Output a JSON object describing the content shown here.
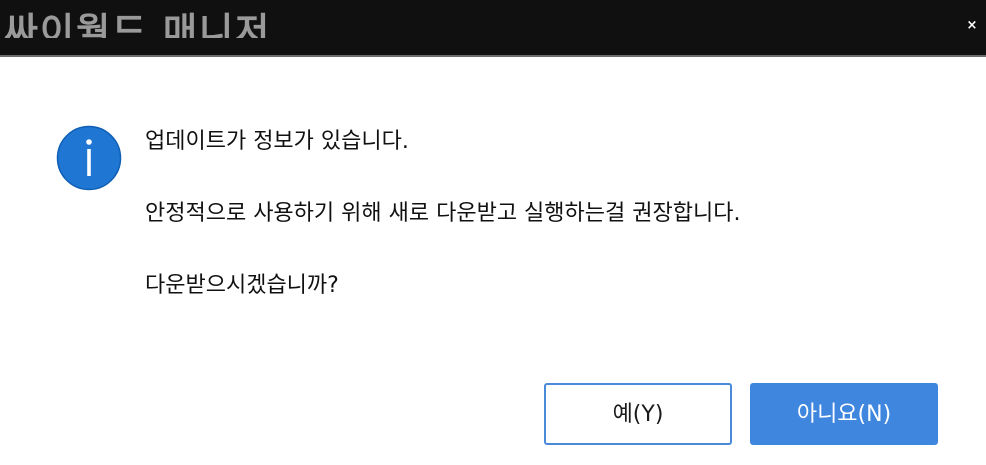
{
  "window": {
    "title": "싸이월드 매니저",
    "close_glyph": "×"
  },
  "dialog": {
    "icon": "info-icon",
    "messages": [
      "업데이트가 정보가 있습니다.",
      "안정적으로 사용하기 위해 새로 다운받고 실행하는걸 권장합니다.",
      "다운받으시겠습니까?"
    ],
    "yes_label": "예(Y)",
    "no_label": "아니요(N)"
  },
  "colors": {
    "titlebar_bg": "#101010",
    "accent": "#3f86df",
    "icon_blue": "#1f76d3"
  }
}
